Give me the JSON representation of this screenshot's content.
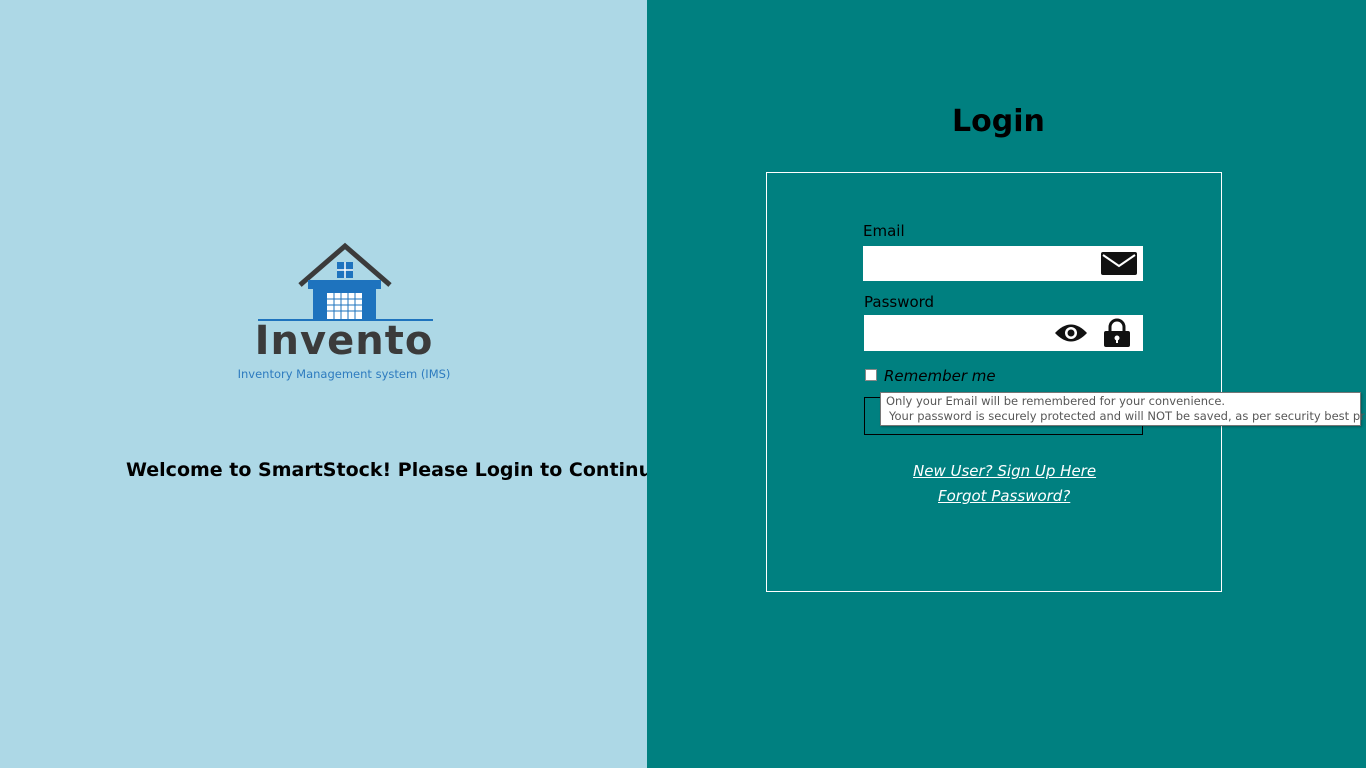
{
  "left_panel": {
    "logo": {
      "name": "Invento",
      "subtitle": "Inventory Management system (IMS)"
    },
    "welcome_text": "Welcome to SmartStock! Please Login to Continue."
  },
  "login": {
    "title": "Login",
    "email": {
      "label": "Email",
      "value": "",
      "icon": "envelope-icon"
    },
    "password": {
      "label": "Password",
      "value": "",
      "icons": [
        "eye-icon",
        "lock-icon"
      ]
    },
    "remember": {
      "label": "Remember me",
      "checked": false
    },
    "tooltip": {
      "line1": "Only your Email will be remembered for your convenience.",
      "line2": "Your password is securely protected and will NOT be saved, as per security best practices."
    },
    "signup_link": "New User? Sign Up Here",
    "forgot_link": "Forgot Password?"
  },
  "colors": {
    "left_bg": "#add8e6",
    "right_bg": "#008080",
    "logo_blue": "#1e73be",
    "logo_gray": "#3b3b3b"
  }
}
